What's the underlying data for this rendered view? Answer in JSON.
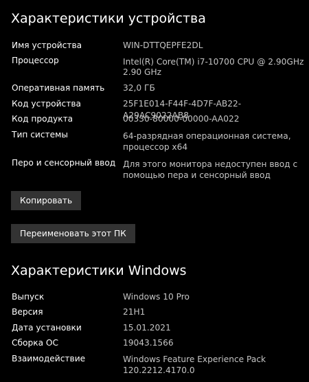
{
  "device_specs": {
    "title": "Характеристики устройства",
    "rows": [
      {
        "label": "Имя устройства",
        "value": "WIN-DTTQEPFE2DL"
      },
      {
        "label": "Процессор",
        "value": "Intel(R) Core(TM) i7-10700 CPU @ 2.90GHz",
        "value2": "2.90 GHz"
      },
      {
        "label": "Оперативная память",
        "value": "32,0 ГБ"
      },
      {
        "label": "Код устройства",
        "value": "25F1E014-F44F-4D7F-AB22-A29AC9022AB8"
      },
      {
        "label": "Код продукта",
        "value": "00330-80000-00000-AA022"
      },
      {
        "label": "Тип системы",
        "value": "64-разрядная операционная система,",
        "value2": "процессор x64"
      },
      {
        "label": "Перо и сенсорный ввод",
        "value": "Для этого монитора недоступен ввод с",
        "value2": "помощью пера и сенсорный ввод"
      }
    ],
    "copy_button": "Копировать",
    "rename_button": "Переименовать этот ПК"
  },
  "windows_specs": {
    "title": "Характеристики Windows",
    "rows": [
      {
        "label": "Выпуск",
        "value": "Windows 10 Pro"
      },
      {
        "label": "Версия",
        "value": "21H1"
      },
      {
        "label": "Дата установки",
        "value": "15.01.2021"
      },
      {
        "label": "Сборка ОС",
        "value": "19043.1566"
      },
      {
        "label": "Взаимодействие",
        "value": "Windows Feature Experience Pack",
        "value2": "120.2212.4170.0"
      }
    ]
  },
  "colors": {
    "background": "#000000",
    "label": "#ffffff",
    "value": "#c5c5c5",
    "button": "#333333"
  }
}
